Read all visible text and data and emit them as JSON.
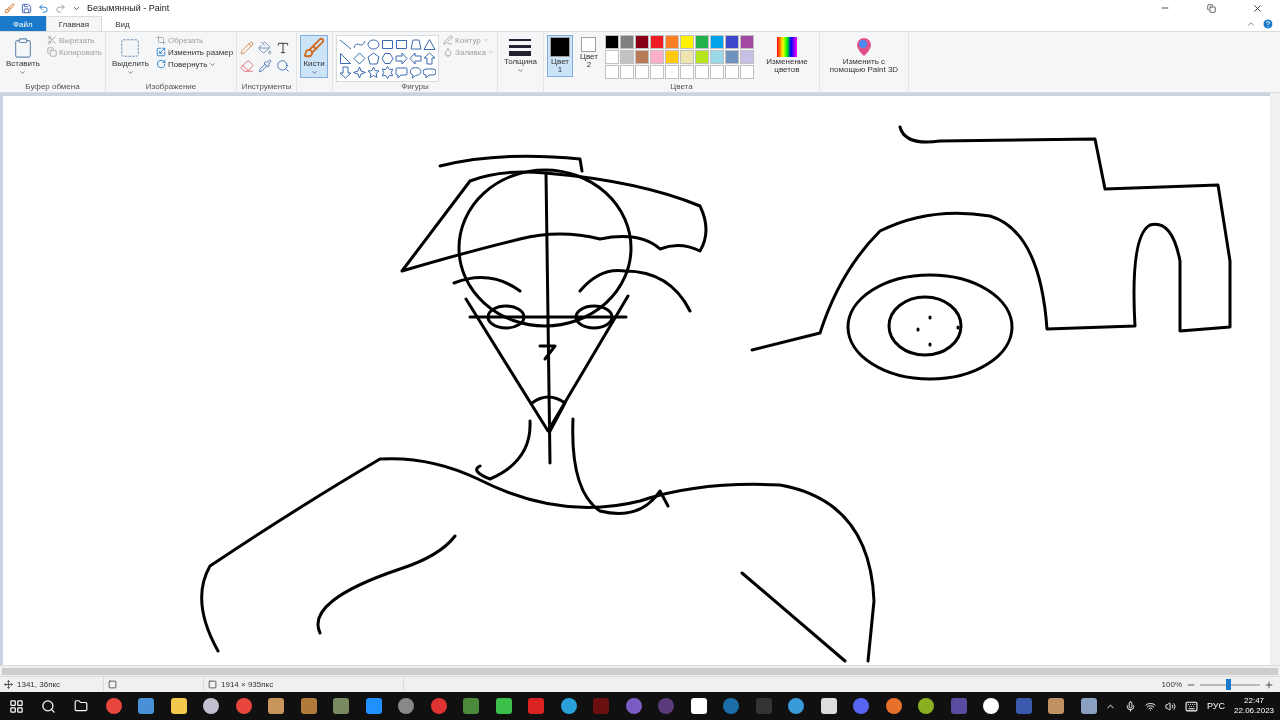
{
  "window": {
    "title": "Безымянный - Paint"
  },
  "tabs": [
    {
      "label": "Файл",
      "selected": false,
      "kind": "file"
    },
    {
      "label": "Главная",
      "selected": true,
      "kind": "tab"
    },
    {
      "label": "Вид",
      "selected": false,
      "kind": "tab"
    }
  ],
  "ribbon": {
    "clipboard": {
      "label": "Буфер обмена",
      "paste": "Вставить",
      "cut": {
        "label": "Вырезать",
        "disabled": true
      },
      "copy": {
        "label": "Копировать",
        "disabled": true
      }
    },
    "image": {
      "label": "Изображение",
      "select": "Выделить",
      "crop": {
        "label": "Обрезать",
        "disabled": true
      },
      "resize": {
        "label": "Изменить размер",
        "disabled": false
      },
      "rotate": {
        "label": "Повернуть",
        "disabled": false
      }
    },
    "tools": {
      "label": "Инструменты"
    },
    "brushes": {
      "label": "Кисти",
      "selected": true
    },
    "shapes": {
      "label": "Фигуры",
      "outline": {
        "label": "Контур",
        "disabled": true
      },
      "fill": {
        "label": "Заливка",
        "disabled": true
      }
    },
    "size": {
      "label": "Толщина"
    },
    "colors": {
      "label": "Цвета",
      "color1": {
        "label": "Цвет 1",
        "color": "#000000",
        "selected": true
      },
      "color2": {
        "label": "Цвет 2",
        "color": "#ffffff",
        "selected": false
      },
      "palette": [
        {
          "color": "#000000"
        },
        {
          "color": "#7f7f7f"
        },
        {
          "color": "#880015"
        },
        {
          "color": "#ed1c24"
        },
        {
          "color": "#ff7f27"
        },
        {
          "color": "#fff200"
        },
        {
          "color": "#22b14c"
        },
        {
          "color": "#00a2e8"
        },
        {
          "color": "#3f48cc"
        },
        {
          "color": "#a349a4"
        },
        {
          "color": "#ffffff"
        },
        {
          "color": "#c3c3c3"
        },
        {
          "color": "#b97a57"
        },
        {
          "color": "#ffaec9"
        },
        {
          "color": "#ffc90e"
        },
        {
          "color": "#efe4b0"
        },
        {
          "color": "#b5e61d"
        },
        {
          "color": "#99d9ea"
        },
        {
          "color": "#7092be"
        },
        {
          "color": "#c8bfe7"
        }
      ],
      "edit": "Изменение цветов"
    },
    "paint3d": "Изменить с помощью Paint 3D"
  },
  "status_bar": {
    "position": "1341, 36пкс",
    "image_size": "1914 × 935пкс",
    "zoom": "100%",
    "zoom_slider": {
      "level": 0.47
    }
  },
  "taskbar": {
    "language": "РУС",
    "time": "22:47",
    "date": "22.06.2023"
  }
}
